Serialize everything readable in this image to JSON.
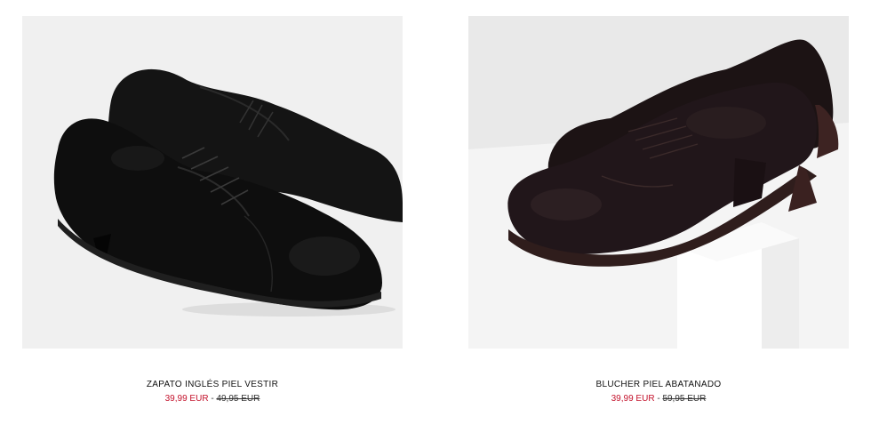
{
  "products": [
    {
      "name": "ZAPATO INGLÉS PIEL VESTIR",
      "sale_price": "39,99 EUR",
      "separator": " - ",
      "old_price": "49,95 EUR",
      "image_icon": "black-oxford-shoes-photo",
      "background": "#f0f0f0"
    },
    {
      "name": "BLUCHER PIEL ABATANADO",
      "sale_price": "39,99 EUR",
      "separator": " - ",
      "old_price": "59,95 EUR",
      "image_icon": "brown-blucher-shoes-photo",
      "background": "#e9e9e9"
    }
  ],
  "colors": {
    "sale": "#c3102a",
    "text": "#111111"
  }
}
